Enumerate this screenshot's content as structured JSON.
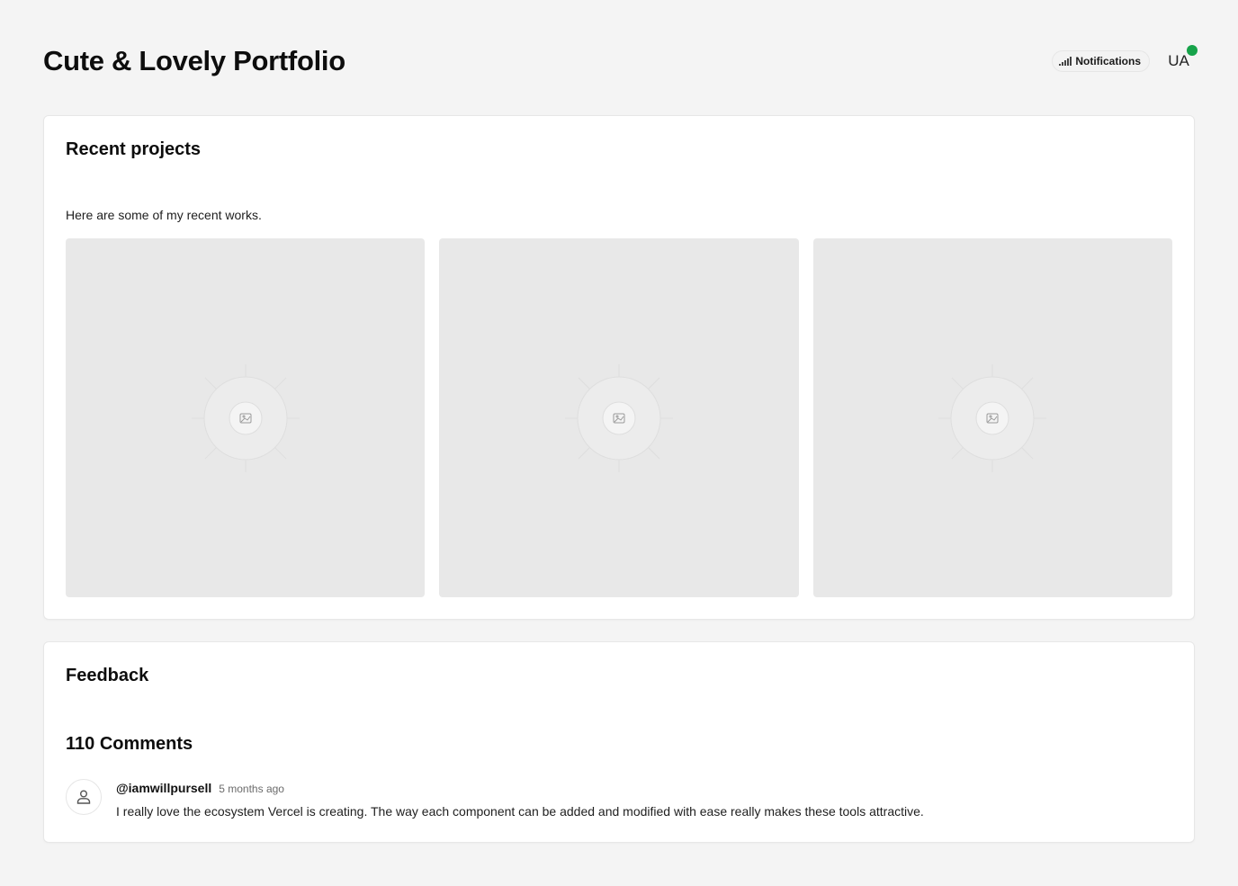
{
  "header": {
    "title": "Cute & Lovely Portfolio",
    "notifications_label": "Notifications",
    "avatar_initials": "UA",
    "online_status_color": "#16a34a"
  },
  "projects": {
    "title": "Recent projects",
    "description": "Here are some of my recent works.",
    "items": [
      {
        "icon": "image-placeholder-icon"
      },
      {
        "icon": "image-placeholder-icon"
      },
      {
        "icon": "image-placeholder-icon"
      }
    ]
  },
  "feedback": {
    "title": "Feedback",
    "comments_count": "110 Comments",
    "comments": [
      {
        "author": "@iamwillpursell",
        "time": "5 months ago",
        "text": "I really love the ecosystem Vercel is creating. The way each component can be added and modified with ease really makes these tools attractive.",
        "avatar_icon": "user-icon"
      }
    ]
  }
}
